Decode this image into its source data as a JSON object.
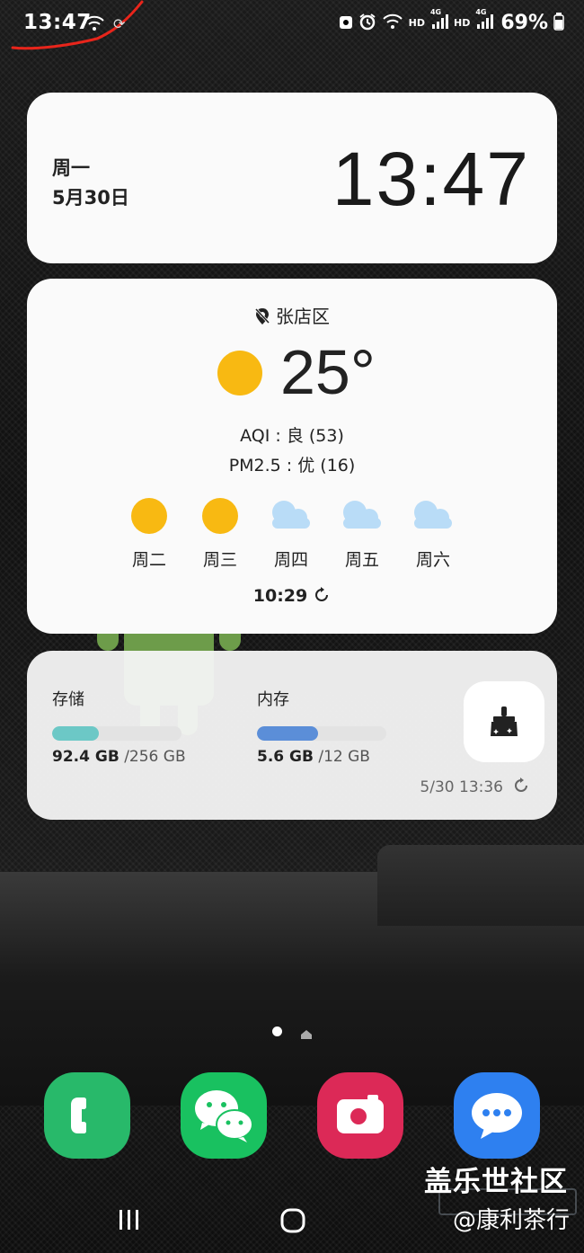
{
  "status_bar": {
    "time": "13:47",
    "hd1": "HD",
    "net1": "4G",
    "hd2": "HD",
    "net2": "4G",
    "battery": "69%"
  },
  "clock_widget": {
    "day": "周一",
    "date": "5月30日",
    "time": "13:47"
  },
  "weather_widget": {
    "location": "张店区",
    "temperature": "25°",
    "aqi": "AQI : 良 (53)",
    "pm25": "PM2.5 : 优 (16)",
    "forecast": [
      {
        "day": "周二",
        "icon": "sun-icon"
      },
      {
        "day": "周三",
        "icon": "sun-icon"
      },
      {
        "day": "周四",
        "icon": "cloud-icon"
      },
      {
        "day": "周五",
        "icon": "cloud-icon"
      },
      {
        "day": "周六",
        "icon": "cloud-icon"
      }
    ],
    "updated": "10:29"
  },
  "device_care_widget": {
    "storage": {
      "label": "存储",
      "used": "92.4 GB",
      "total": "/256 GB",
      "fraction": 0.36
    },
    "memory": {
      "label": "内存",
      "used": "5.6 GB",
      "total": "/12 GB",
      "fraction": 0.47
    },
    "updated": "5/30 13:36"
  },
  "dock": [
    {
      "name": "phone-app",
      "icon": "phone-icon"
    },
    {
      "name": "wechat-app",
      "icon": "wechat-icon"
    },
    {
      "name": "camera-app",
      "icon": "camera-icon"
    },
    {
      "name": "messages-app",
      "icon": "chat-bubble-icon"
    }
  ],
  "watermark": {
    "line1": "盖乐世社区",
    "line2": "@康利茶行"
  },
  "colors": {
    "sun": "#f8b912",
    "cloud": "#b9dcf7",
    "storage_bar": "#6cc8c6",
    "memory_bar": "#5b8ed8",
    "phone": "#28b96a",
    "wechat": "#19c160",
    "camera": "#dc2957",
    "messages": "#2e80f0"
  }
}
